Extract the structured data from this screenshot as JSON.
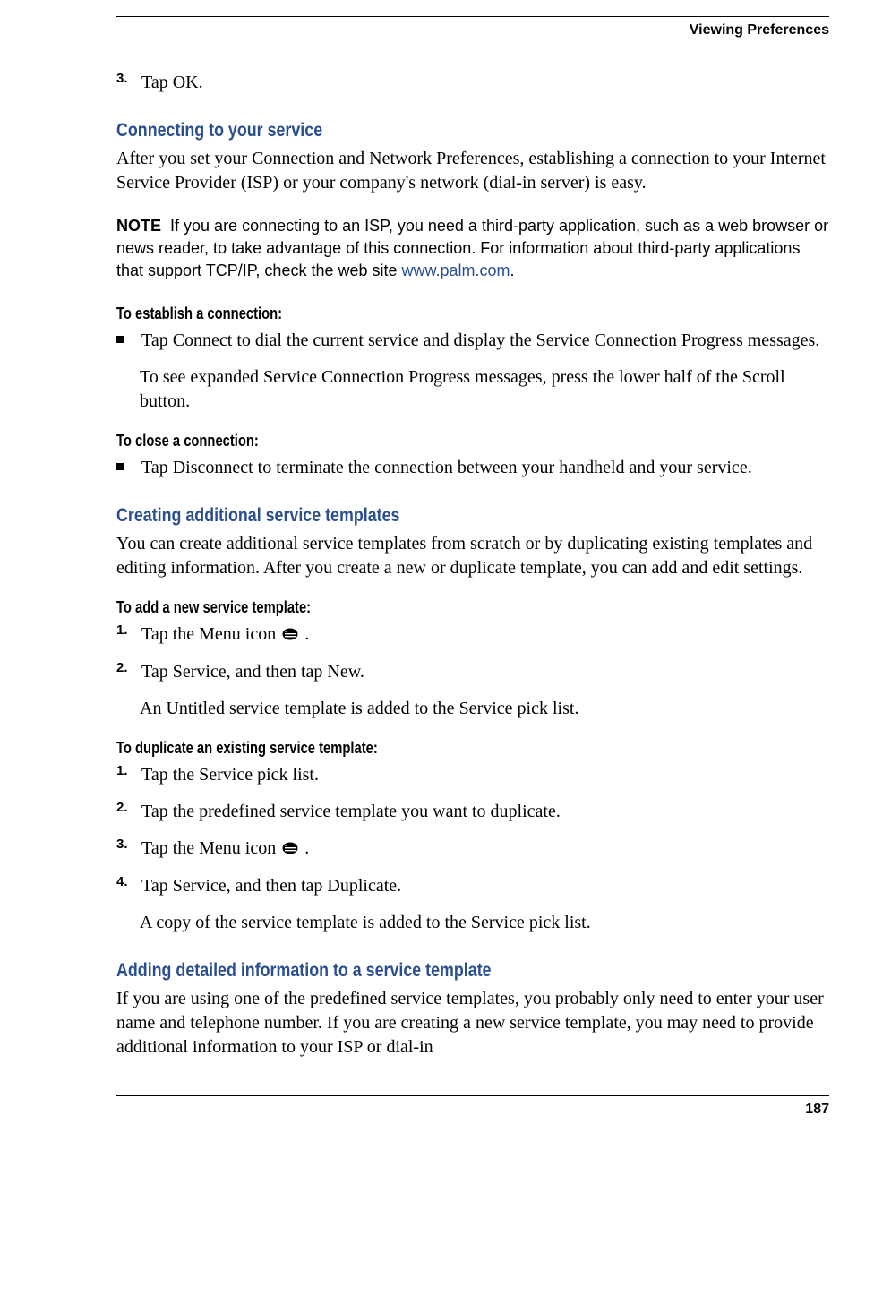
{
  "header": {
    "title": "Viewing Preferences"
  },
  "intro_step": {
    "num": "3.",
    "text": "Tap OK."
  },
  "section1": {
    "heading": "Connecting to your service",
    "body": "After you set your Connection and Network Preferences, establishing a connection to your Internet Service Provider (ISP) or your company's network (dial-in server) is easy."
  },
  "note": {
    "label": "NOTE",
    "text_before_link": "If you are connecting to an ISP, you need a third-party application, such as a web browser or news reader, to take advantage of this connection. For information about third-party applications that support TCP/IP, check the web site ",
    "link": "www.palm.com",
    "text_after_link": "."
  },
  "establish": {
    "heading": "To establish a connection:",
    "bullet_text": "Tap Connect to dial the current service and display the Service Connection Progress messages.",
    "bullet_sub": "To see expanded Service Connection Progress messages, press the lower half of the Scroll button."
  },
  "close": {
    "heading": "To close a connection:",
    "bullet_text": "Tap Disconnect to terminate the connection between your handheld and your service."
  },
  "section2": {
    "heading": "Creating additional service templates",
    "body": "You can create additional service templates from scratch or by duplicating existing templates and editing information. After you create a new or duplicate template, you can add and edit settings."
  },
  "add_template": {
    "heading": "To add a new service template:",
    "steps": [
      {
        "num": "1.",
        "text_before": "Tap the Menu icon ",
        "has_icon": true,
        "text_after": " ."
      },
      {
        "num": "2.",
        "text": "Tap Service, and then tap New.",
        "sub": "An Untitled service template is added to the Service pick list."
      }
    ]
  },
  "dup_template": {
    "heading": "To duplicate an existing service template:",
    "steps": [
      {
        "num": "1.",
        "text": "Tap the Service pick list."
      },
      {
        "num": "2.",
        "text": "Tap the predefined service template you want to duplicate."
      },
      {
        "num": "3.",
        "text_before": "Tap the Menu icon ",
        "has_icon": true,
        "text_after": " ."
      },
      {
        "num": "4.",
        "text": "Tap Service, and then tap Duplicate.",
        "sub": "A copy of the service template is added to the Service pick list."
      }
    ]
  },
  "section3": {
    "heading": "Adding detailed information to a service template",
    "body": "If you are using one of the predefined service templates, you probably only need to enter your user name and telephone number. If you are creating a new service template, you may need to provide additional information to your ISP or dial-in"
  },
  "footer": {
    "page_number": "187"
  }
}
